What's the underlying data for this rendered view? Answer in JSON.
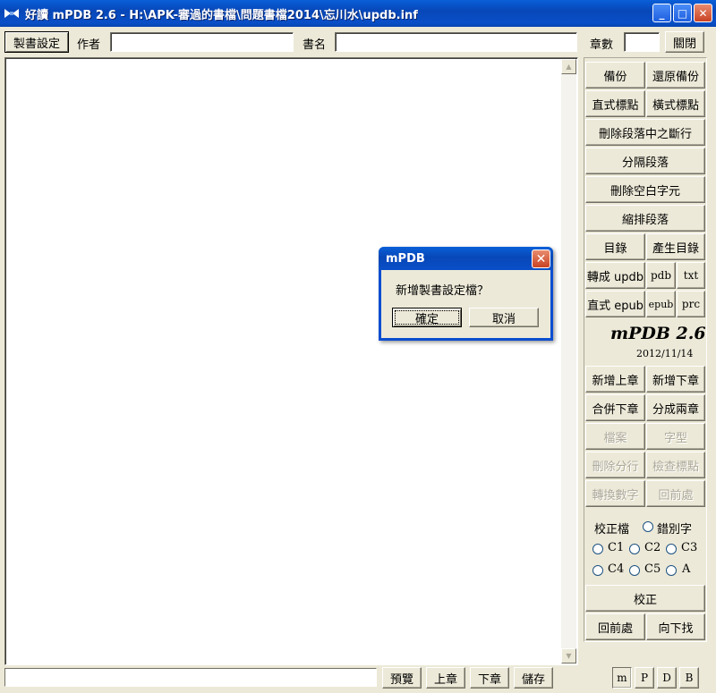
{
  "window": {
    "title": "好讀 mPDB 2.6 - H:\\APK-審過的書檔\\問題書檔2014\\忘川水\\updb.inf",
    "minimize": "_",
    "maximize": "□",
    "close": "✕"
  },
  "toolbar": {
    "book_settings": "製書設定",
    "author_label": "作者",
    "author_value": "",
    "title_label": "書名",
    "title_value": "",
    "chapters_label": "章數",
    "chapters_value": "",
    "close_label": "關閉"
  },
  "panel": {
    "backup": "備份",
    "restore_backup": "還原備份",
    "vertical_punct": "直式標點",
    "horizontal_punct": "橫式標點",
    "remove_breaks": "刪除段落中之斷行",
    "separate_paragraphs": "分隔段落",
    "remove_blank": "刪除空白字元",
    "indent_paragraphs": "縮排段落",
    "toc": "目錄",
    "generate_toc": "產生目錄",
    "to_updb": "轉成 updb",
    "pdb": "pdb",
    "txt": "txt",
    "vertical_epub": "直式 epub",
    "epub": "epub",
    "prc": "prc",
    "brand": "mPDB 2.6",
    "brand_date": "2012/11/14",
    "add_prev_chapter": "新增上章",
    "add_next_chapter": "新增下章",
    "merge_next": "合併下章",
    "split_two": "分成兩章",
    "file": "檔案",
    "font": "字型",
    "delete_split": "刪除分行",
    "check_punct": "檢查標點",
    "convert_digits": "轉換數字",
    "prev_location": "回前處",
    "proof_file": "校正檔",
    "typo": "錯別字",
    "radios": [
      "C1",
      "C2",
      "C3",
      "C4",
      "C5",
      "A"
    ],
    "proofread": "校正",
    "go_back": "回前處",
    "find_next": "向下找"
  },
  "bottom": {
    "status_value": "",
    "preview": "預覽",
    "prev_chapter": "上章",
    "next_chapter": "下章",
    "save": "儲存",
    "modes": [
      "m",
      "P",
      "D",
      "B"
    ]
  },
  "dialog": {
    "title": "mPDB",
    "message": "新增製書設定檔？",
    "ok": "確定",
    "cancel": "取消"
  }
}
